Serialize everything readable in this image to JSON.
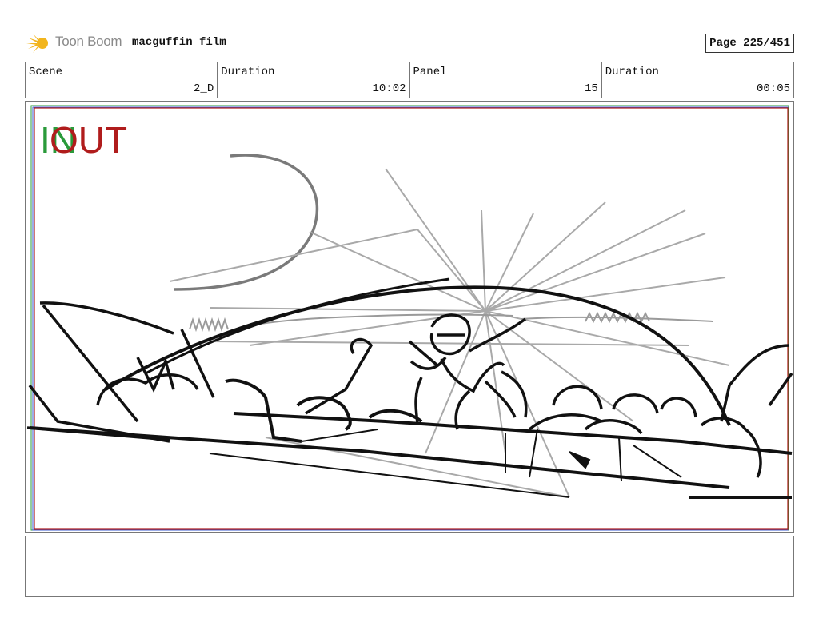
{
  "header": {
    "brand": "Toon Boom",
    "project_title": "macguffin film",
    "page_label": "Page 225/451",
    "logo_icon": "toon-boom-sun-icon",
    "logo_color": "#f2b51d"
  },
  "info": {
    "scene_label": "Scene",
    "scene_value": "2_D",
    "duration_label": "Duration",
    "duration_value": "10:02",
    "panel_label": "Panel",
    "panel_value": "15",
    "panel_duration_label": "Duration",
    "panel_duration_value": "00:05"
  },
  "panel": {
    "in_label": "IN",
    "out_label": "OUT",
    "in_color": "#2a9a3a",
    "out_color": "#b01c1c"
  },
  "notes": {
    "text": ""
  }
}
